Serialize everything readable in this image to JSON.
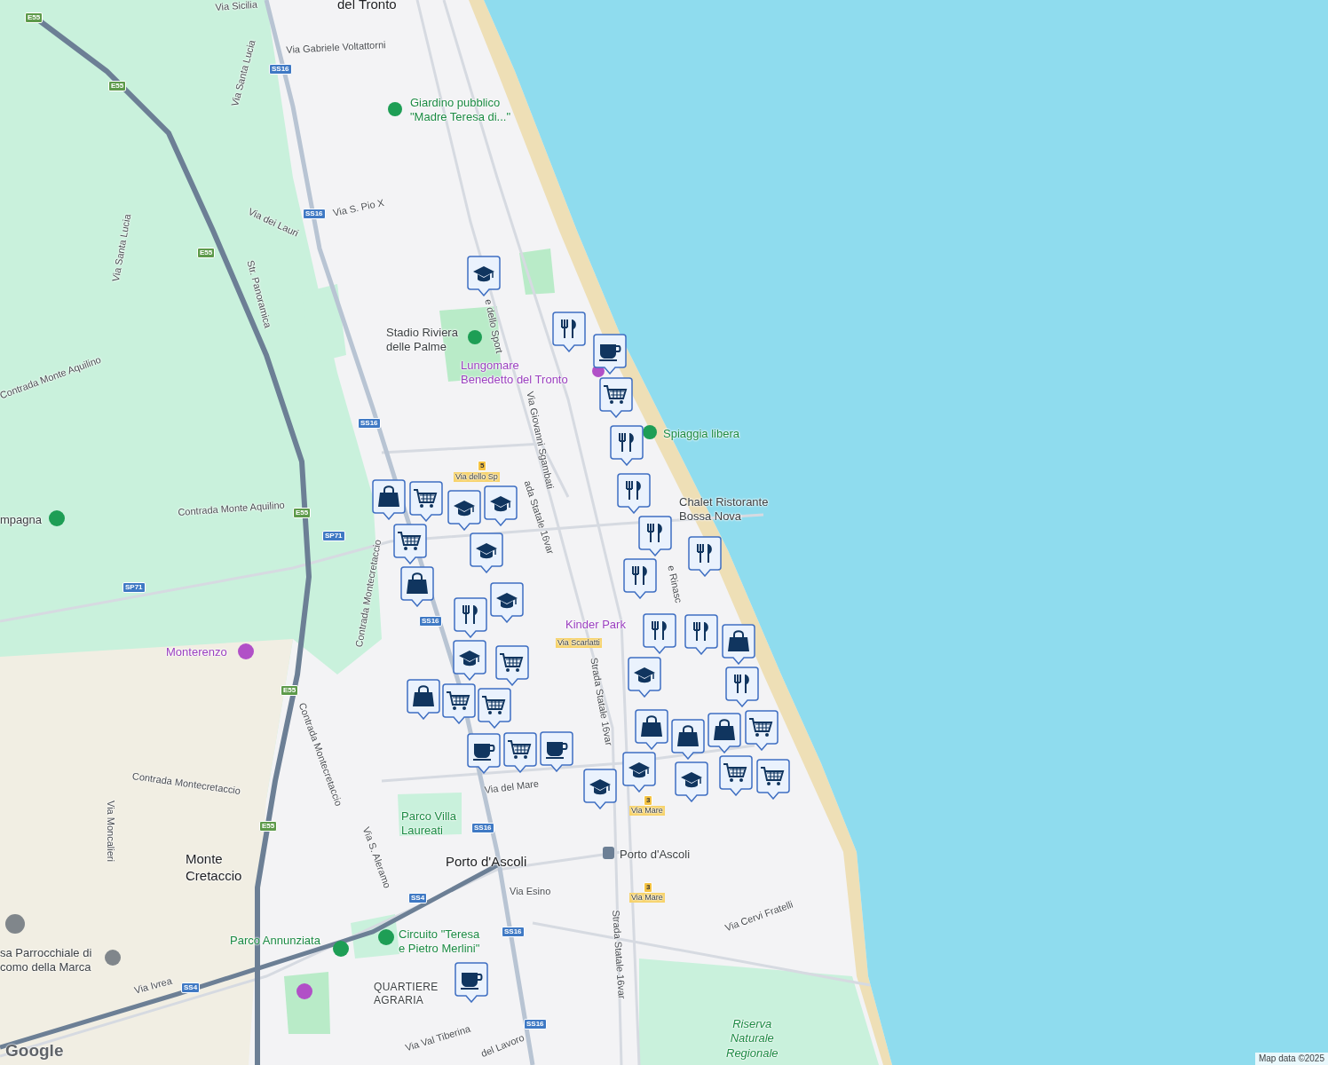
{
  "map_labels": [
    {
      "kind": "place",
      "lines": [
        "del Tronto"
      ]
    },
    {
      "kind": "street",
      "lines": [
        "Via Sicilia"
      ]
    },
    {
      "kind": "street",
      "lines": [
        "Via Gabriele Voltattorni"
      ]
    },
    {
      "kind": "street",
      "lines": [
        "Via Santa Lucia"
      ]
    },
    {
      "kind": "park",
      "lines": [
        "Giardino pubblico",
        "\"Madre Teresa di...\""
      ]
    },
    {
      "kind": "street",
      "lines": [
        "Via dei Lauri"
      ]
    },
    {
      "kind": "street",
      "lines": [
        "Via S. Pio X"
      ]
    },
    {
      "kind": "street",
      "lines": [
        "Via Santa Lucia"
      ]
    },
    {
      "kind": "street",
      "lines": [
        "Str. Panoramica"
      ]
    },
    {
      "kind": "street",
      "lines": [
        "Contrada Monte Aquilino"
      ]
    },
    {
      "kind": "poi",
      "lines": [
        "Stadio Riviera",
        "delle Palme"
      ]
    },
    {
      "kind": "attraction",
      "lines": [
        "Lungomare",
        "Benedetto del Tronto"
      ]
    },
    {
      "kind": "street",
      "lines": [
        "e dello Sport"
      ]
    },
    {
      "kind": "street",
      "lines": [
        "Via Giovanni Sgambati"
      ]
    },
    {
      "kind": "park",
      "lines": [
        "Spiaggia libera"
      ]
    },
    {
      "kind": "poi",
      "lines": [
        "Chalet Ristorante",
        "Bossa Nova"
      ]
    },
    {
      "kind": "street",
      "lines": [
        "ada Statale 16var"
      ]
    },
    {
      "kind": "street",
      "lines": [
        "Contrada Monte Aquilino"
      ]
    },
    {
      "kind": "poi",
      "lines": [
        "mpagna"
      ]
    },
    {
      "kind": "street",
      "lines": [
        "Contrada Montecretaccio"
      ]
    },
    {
      "kind": "street",
      "lines": [
        "e Rinasc"
      ]
    },
    {
      "kind": "attraction",
      "lines": [
        "Kinder Park"
      ]
    },
    {
      "kind": "attraction",
      "lines": [
        "Monterenzo"
      ]
    },
    {
      "kind": "street",
      "lines": [
        "Contrada Montecretaccio"
      ]
    },
    {
      "kind": "street",
      "lines": [
        "Contrada Montecretaccio"
      ]
    },
    {
      "kind": "street",
      "lines": [
        "Via Moncalieri"
      ]
    },
    {
      "kind": "street",
      "lines": [
        "Strada Statale 16var"
      ]
    },
    {
      "kind": "street",
      "lines": [
        "Via del Mare"
      ]
    },
    {
      "kind": "park",
      "lines": [
        "Parco Villa",
        "Laureati"
      ]
    },
    {
      "kind": "place",
      "lines": [
        "Monte",
        "Cretaccio"
      ]
    },
    {
      "kind": "place",
      "lines": [
        "Porto d'Ascoli"
      ]
    },
    {
      "kind": "street",
      "lines": [
        "Via S. Aleramo"
      ]
    },
    {
      "kind": "street",
      "lines": [
        "Via Esino"
      ]
    },
    {
      "kind": "poi",
      "lines": [
        "Porto d'Ascoli"
      ]
    },
    {
      "kind": "street",
      "lines": [
        "Via Cervi Fratelli"
      ]
    },
    {
      "kind": "poi",
      "lines": [
        "sa Parrocchiale di",
        "como della Marca"
      ]
    },
    {
      "kind": "park",
      "lines": [
        "Parco Annunziata"
      ]
    },
    {
      "kind": "park",
      "lines": [
        "Circuito \"Teresa",
        "e Pietro Merlini\""
      ]
    },
    {
      "kind": "street",
      "lines": [
        "Via Ivrea"
      ]
    },
    {
      "kind": "district",
      "lines": [
        "QUARTIERE",
        "AGRARIA"
      ]
    },
    {
      "kind": "street",
      "lines": [
        "Strada Statale 16var"
      ]
    },
    {
      "kind": "park",
      "lines": [
        "Riserva",
        "Naturale",
        "Regionale"
      ]
    },
    {
      "kind": "street",
      "lines": [
        "Via Val Tiberina"
      ]
    },
    {
      "kind": "street",
      "lines": [
        "del Lavoro"
      ]
    },
    {
      "kind": "tag",
      "lines": [
        "Via Scarlatti"
      ]
    },
    {
      "kind": "tag",
      "lines": [
        "Via dello Sp"
      ]
    },
    {
      "kind": "tag",
      "lines": [
        "Via Mare"
      ]
    },
    {
      "kind": "tag",
      "lines": [
        "Via Mare"
      ]
    }
  ],
  "road_shields": [
    {
      "text": "E55",
      "color": "#5d9a4a"
    },
    {
      "text": "E55",
      "color": "#5d9a4a"
    },
    {
      "text": "E55",
      "color": "#5d9a4a"
    },
    {
      "text": "E55",
      "color": "#5d9a4a"
    },
    {
      "text": "E55",
      "color": "#5d9a4a"
    },
    {
      "text": "E55",
      "color": "#5d9a4a"
    },
    {
      "text": "SS16",
      "color": "#3f79c4"
    },
    {
      "text": "SS16",
      "color": "#3f79c4"
    },
    {
      "text": "SS16",
      "color": "#3f79c4"
    },
    {
      "text": "SS16",
      "color": "#3f79c4"
    },
    {
      "text": "SS16",
      "color": "#3f79c4"
    },
    {
      "text": "SS16",
      "color": "#3f79c4"
    },
    {
      "text": "SS16",
      "color": "#3f79c4"
    },
    {
      "text": "SP71",
      "color": "#3f79c4"
    },
    {
      "text": "SP71",
      "color": "#3f79c4"
    },
    {
      "text": "SS4",
      "color": "#3f79c4"
    },
    {
      "text": "SS4",
      "color": "#3f79c4"
    },
    {
      "text": "5",
      "color": "#f5c342"
    },
    {
      "text": "3",
      "color": "#f5c342"
    },
    {
      "text": "3",
      "color": "#f5c342"
    }
  ],
  "markers": [
    {
      "kind": "school"
    },
    {
      "kind": "restaurant"
    },
    {
      "kind": "cafe"
    },
    {
      "kind": "cart"
    },
    {
      "kind": "restaurant"
    },
    {
      "kind": "restaurant"
    },
    {
      "kind": "restaurant"
    },
    {
      "kind": "school"
    },
    {
      "kind": "school"
    },
    {
      "kind": "school"
    },
    {
      "kind": "cart"
    },
    {
      "kind": "shopping"
    },
    {
      "kind": "cart"
    },
    {
      "kind": "shopping"
    },
    {
      "kind": "restaurant"
    },
    {
      "kind": "restaurant"
    },
    {
      "kind": "restaurant"
    },
    {
      "kind": "school"
    },
    {
      "kind": "restaurant"
    },
    {
      "kind": "school"
    },
    {
      "kind": "school"
    },
    {
      "kind": "restaurant"
    },
    {
      "kind": "shopping"
    },
    {
      "kind": "restaurant"
    },
    {
      "kind": "cart"
    },
    {
      "kind": "cart"
    },
    {
      "kind": "cart"
    },
    {
      "kind": "shopping"
    },
    {
      "kind": "cafe"
    },
    {
      "kind": "cart"
    },
    {
      "kind": "cafe"
    },
    {
      "kind": "school"
    },
    {
      "kind": "school"
    },
    {
      "kind": "shopping"
    },
    {
      "kind": "shopping"
    },
    {
      "kind": "shopping"
    },
    {
      "kind": "cart"
    },
    {
      "kind": "cart"
    },
    {
      "kind": "school"
    },
    {
      "kind": "cart"
    },
    {
      "kind": "cafe"
    }
  ],
  "logo": "Google",
  "attribution": "Map data ©2025"
}
